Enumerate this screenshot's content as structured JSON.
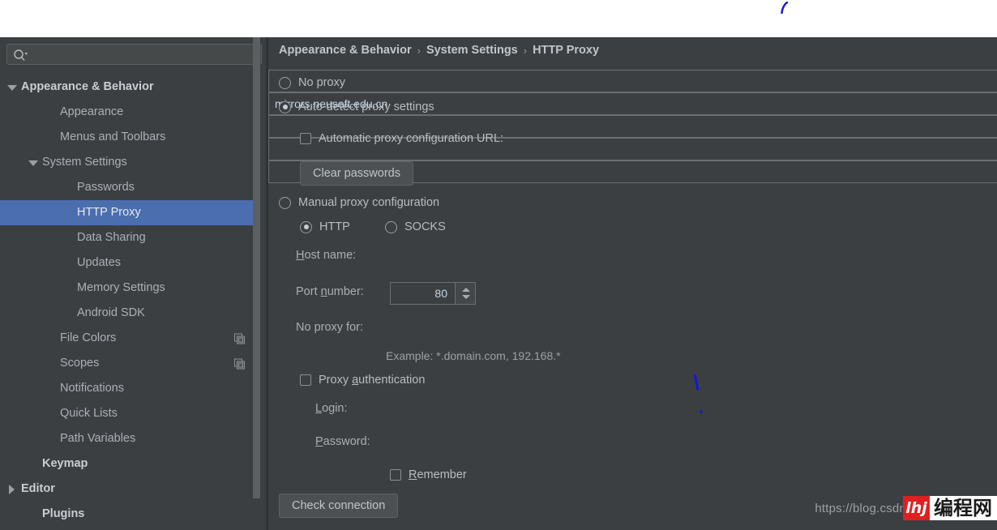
{
  "search": {
    "value": "",
    "placeholder": "",
    "icon": "search-icon"
  },
  "sidebar": {
    "items": [
      {
        "label": "Appearance & Behavior",
        "indent": 8,
        "twisty": "down",
        "bold": true,
        "selected": false,
        "badge": false
      },
      {
        "label": "Appearance",
        "indent": 56,
        "twisty": "none",
        "bold": false,
        "selected": false,
        "badge": false
      },
      {
        "label": "Menus and Toolbars",
        "indent": 56,
        "twisty": "none",
        "bold": false,
        "selected": false,
        "badge": false
      },
      {
        "label": "System Settings",
        "indent": 34,
        "twisty": "down",
        "bold": false,
        "selected": false,
        "badge": false
      },
      {
        "label": "Passwords",
        "indent": 77,
        "twisty": "none",
        "bold": false,
        "selected": false,
        "badge": false
      },
      {
        "label": "HTTP Proxy",
        "indent": 77,
        "twisty": "none",
        "bold": false,
        "selected": true,
        "badge": false
      },
      {
        "label": "Data Sharing",
        "indent": 77,
        "twisty": "none",
        "bold": false,
        "selected": false,
        "badge": false
      },
      {
        "label": "Updates",
        "indent": 77,
        "twisty": "none",
        "bold": false,
        "selected": false,
        "badge": false
      },
      {
        "label": "Memory Settings",
        "indent": 77,
        "twisty": "none",
        "bold": false,
        "selected": false,
        "badge": false
      },
      {
        "label": "Android SDK",
        "indent": 77,
        "twisty": "none",
        "bold": false,
        "selected": false,
        "badge": false
      },
      {
        "label": "File Colors",
        "indent": 56,
        "twisty": "none",
        "bold": false,
        "selected": false,
        "badge": true
      },
      {
        "label": "Scopes",
        "indent": 56,
        "twisty": "none",
        "bold": false,
        "selected": false,
        "badge": true
      },
      {
        "label": "Notifications",
        "indent": 56,
        "twisty": "none",
        "bold": false,
        "selected": false,
        "badge": false
      },
      {
        "label": "Quick Lists",
        "indent": 56,
        "twisty": "none",
        "bold": false,
        "selected": false,
        "badge": false
      },
      {
        "label": "Path Variables",
        "indent": 56,
        "twisty": "none",
        "bold": false,
        "selected": false,
        "badge": false
      },
      {
        "label": "Keymap",
        "indent": 34,
        "twisty": "none",
        "bold": true,
        "selected": false,
        "badge": false
      },
      {
        "label": "Editor",
        "indent": 8,
        "twisty": "right",
        "bold": true,
        "selected": false,
        "badge": false
      },
      {
        "label": "Plugins",
        "indent": 34,
        "twisty": "none",
        "bold": true,
        "selected": false,
        "badge": false
      }
    ]
  },
  "breadcrumb": {
    "separator": "›",
    "crumbs": [
      "Appearance & Behavior",
      "System Settings",
      "HTTP Proxy"
    ]
  },
  "form": {
    "no_proxy": {
      "label": "No proxy",
      "checked": false
    },
    "auto_detect": {
      "label": "Auto-detect proxy settings",
      "checked": true
    },
    "auto_config_url": {
      "label_pre": "Automatic proxy configuration URL:",
      "checked": false,
      "value": ""
    },
    "clear_passwords_label": "Clear passwords",
    "manual": {
      "label": "Manual proxy configuration",
      "checked": false
    },
    "protocol": {
      "http": {
        "label": "HTTP",
        "checked": true
      },
      "socks": {
        "label": "SOCKS",
        "checked": false
      }
    },
    "host_name": {
      "label_a": "H",
      "label_b": "ost name:",
      "value": "mirrors.neusoft.edu.cn"
    },
    "port_number": {
      "label_a": "Port ",
      "label_b": "n",
      "label_c": "umber:",
      "value": "80"
    },
    "no_proxy_for": {
      "label": "No proxy for:",
      "value": ""
    },
    "example_hint": "Example: *.domain.com, 192.168.*",
    "proxy_auth": {
      "label_a": "Proxy ",
      "label_b": "a",
      "label_c": "uthentication",
      "checked": false
    },
    "login": {
      "label_a": "L",
      "label_b": "ogin:",
      "value": ""
    },
    "password": {
      "label_a": "P",
      "label_b": "assword:",
      "value": ""
    },
    "remember": {
      "label_a": "R",
      "label_b": "emember",
      "checked": false
    },
    "check_connection_label": "Check connection"
  },
  "watermark": {
    "url": "https://blog.csdn",
    "mark": "lhj",
    "text": "编程网"
  },
  "colors": {
    "panel_bg": "#3c3f41",
    "selection": "#4b6eaf",
    "text": "#b7bdc2",
    "field_text": "#c5d4e8",
    "ink": "#1414e0",
    "badge_red": "#e02020"
  }
}
